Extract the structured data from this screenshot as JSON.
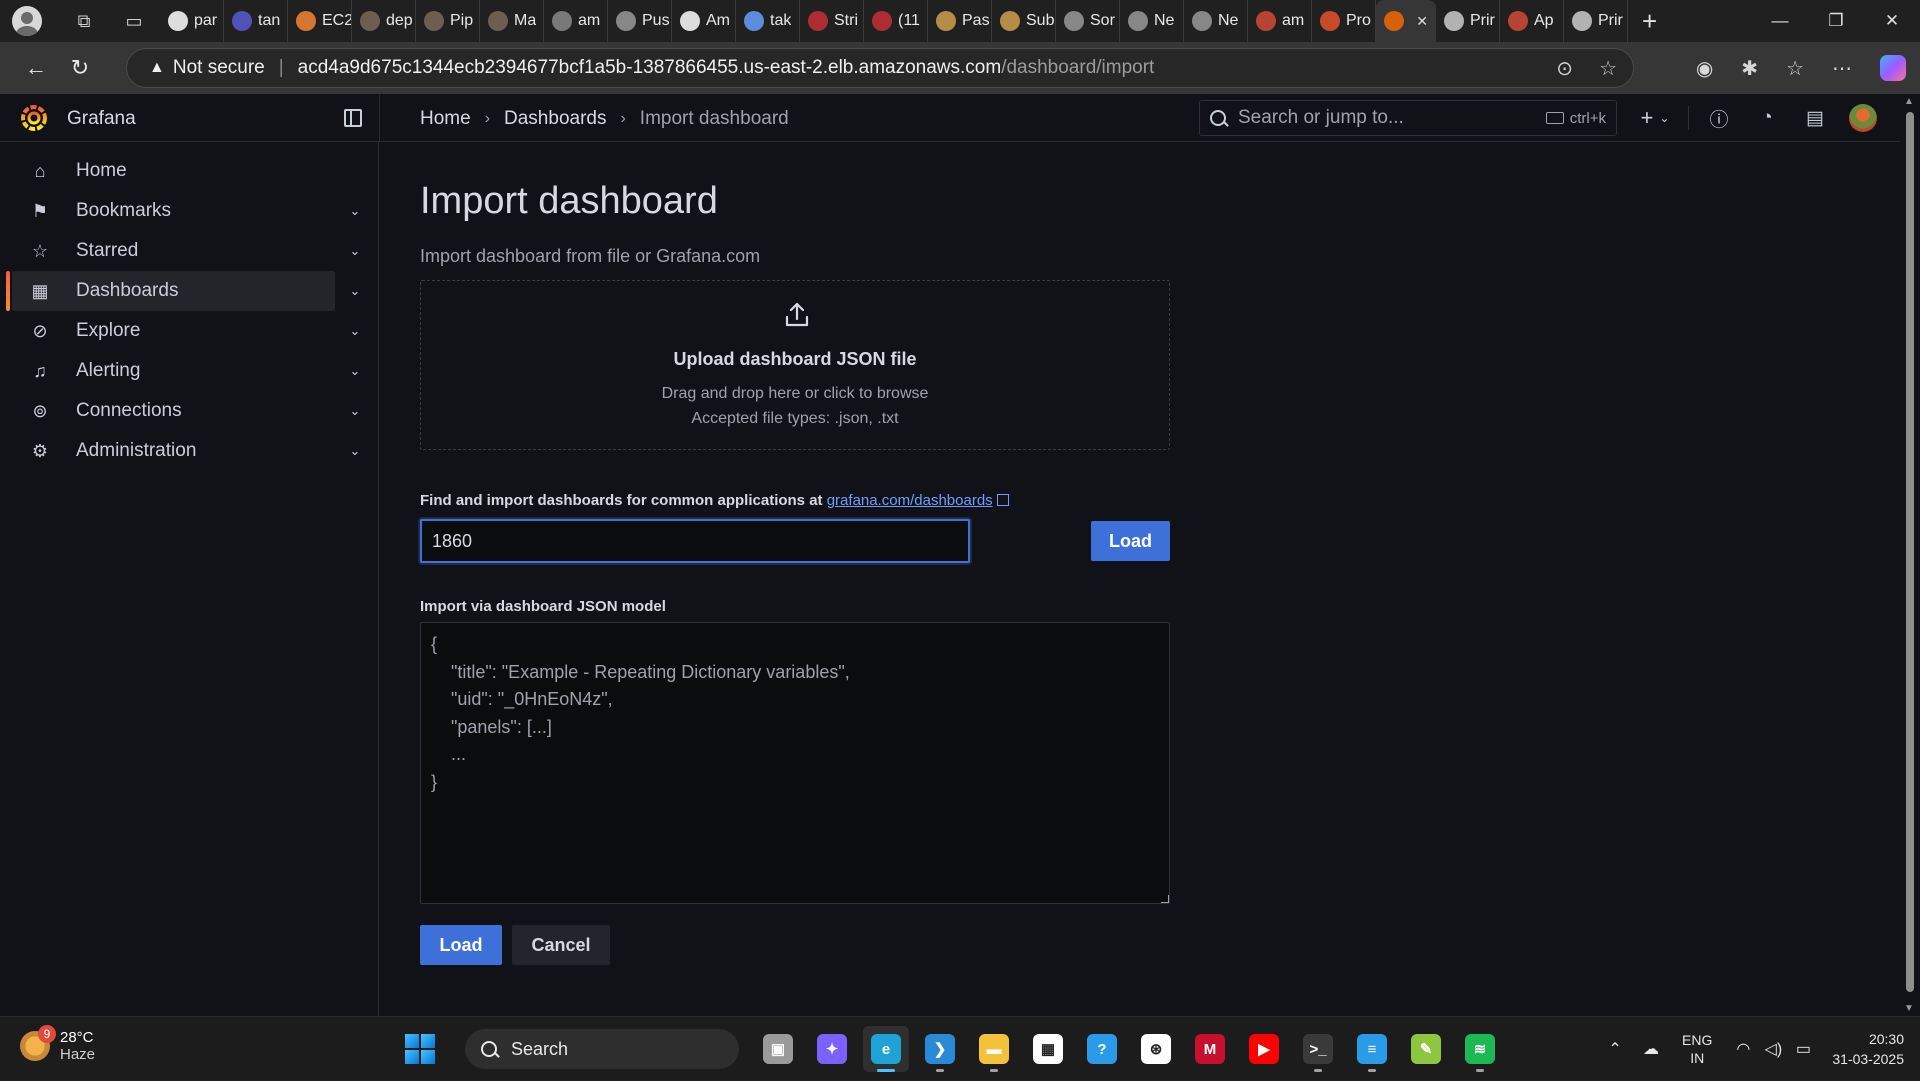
{
  "browser": {
    "tabs": [
      {
        "title": "par",
        "icon": "github-icon",
        "color": "#ffffff"
      },
      {
        "title": "tan",
        "icon": "extension-icon",
        "color": "#5b5bd6"
      },
      {
        "title": "EC2",
        "icon": "aws-ec2-icon",
        "color": "#f58536"
      },
      {
        "title": "dep",
        "icon": "user-avatar-icon",
        "color": "#7a6a5a"
      },
      {
        "title": "Pip",
        "icon": "user-avatar-icon",
        "color": "#7a6a5a"
      },
      {
        "title": "Ma",
        "icon": "user-avatar-icon",
        "color": "#7a6a5a"
      },
      {
        "title": "am",
        "icon": "feather-icon",
        "color": "#8a8a8a"
      },
      {
        "title": "Pus",
        "icon": "openai-icon",
        "color": "#9a9a9a"
      },
      {
        "title": "Am",
        "icon": "github-icon",
        "color": "#ffffff"
      },
      {
        "title": "tak",
        "icon": "search-icon",
        "color": "#6aa0ff"
      },
      {
        "title": "Stri",
        "icon": "flipkart-icon",
        "color": "#c8303a"
      },
      {
        "title": "(11",
        "icon": "youtube-icon",
        "color": "#c8303a"
      },
      {
        "title": "Pas",
        "icon": "dev-icon",
        "color": "#d0a050"
      },
      {
        "title": "Sub",
        "icon": "dev-icon",
        "color": "#d0a050"
      },
      {
        "title": "Sor",
        "icon": "openai-icon",
        "color": "#9a9a9a"
      },
      {
        "title": "Ne",
        "icon": "page-icon",
        "color": "#9a9a9a"
      },
      {
        "title": "Ne",
        "icon": "page-icon",
        "color": "#9a9a9a"
      },
      {
        "title": "am",
        "icon": "prometheus-icon",
        "color": "#d24a3a"
      },
      {
        "title": "Pro",
        "icon": "prometheus-icon",
        "color": "#e6522c"
      }
    ],
    "active_tab": {
      "icon": "grafana-icon",
      "color": "#f46800"
    },
    "tabs_after": [
      {
        "title": "Prir",
        "icon": "globe-icon",
        "color": "#cccccc"
      },
      {
        "title": "Ap",
        "icon": "prometheus-icon",
        "color": "#d24a3a"
      },
      {
        "title": "Prir",
        "icon": "globe-icon",
        "color": "#cccccc"
      }
    ],
    "security_label": "Not secure",
    "url_host": "acd4a9d675c1344ecb2394677bcf1a5b-1387866455.us-east-2.elb.amazonaws.com",
    "url_path": "/dashboard/import"
  },
  "grafana": {
    "brand": "Grafana",
    "breadcrumb": {
      "home": "Home",
      "dashboards": "Dashboards",
      "current": "Import dashboard"
    },
    "search": {
      "placeholder": "Search or jump to...",
      "shortcut": "ctrl+k"
    },
    "sidebar": {
      "items": [
        {
          "label": "Home",
          "icon": "home-icon"
        },
        {
          "label": "Bookmarks",
          "icon": "bookmark-icon"
        },
        {
          "label": "Starred",
          "icon": "star-icon"
        },
        {
          "label": "Dashboards",
          "icon": "apps-icon"
        },
        {
          "label": "Explore",
          "icon": "compass-icon"
        },
        {
          "label": "Alerting",
          "icon": "bell-icon"
        },
        {
          "label": "Connections",
          "icon": "connections-icon"
        },
        {
          "label": "Administration",
          "icon": "cog-icon"
        }
      ]
    },
    "page": {
      "title": "Import dashboard",
      "subtitle": "Import dashboard from file or Grafana.com",
      "upload": {
        "title": "Upload dashboard JSON file",
        "hint": "Drag and drop here or click to browse",
        "types": "Accepted file types: .json, .txt"
      },
      "find_label": "Find and import dashboards for common applications at",
      "find_link": "grafana.com/dashboards",
      "id_value": "1860",
      "load_label": "Load",
      "json_label": "Import via dashboard JSON model",
      "json_placeholder": "{\n    \"title\": \"Example - Repeating Dictionary variables\",\n    \"uid\": \"_0HnEoN4z\",\n    \"panels\": [...]\n    ...\n}",
      "submit_label": "Load",
      "cancel_label": "Cancel"
    },
    "accent": "#3d71d9"
  },
  "taskbar": {
    "weather_badge": "9",
    "temperature": "28°C",
    "condition": "Haze",
    "search_label": "Search",
    "apps": [
      {
        "icon": "task-view-icon",
        "color": "#9a9a9a",
        "glyph": "▣"
      },
      {
        "icon": "copilot-icon",
        "color": "#7b61ff",
        "glyph": "✦"
      },
      {
        "icon": "edge-icon",
        "color": "#1fa3d6",
        "glyph": "e"
      },
      {
        "icon": "vscode-icon",
        "color": "#2b8ad8",
        "glyph": "❯"
      },
      {
        "icon": "file-explorer-icon",
        "color": "#f3c13a",
        "glyph": "▬"
      },
      {
        "icon": "microsoft-store-icon",
        "color": "#ffffff",
        "glyph": "▦"
      },
      {
        "icon": "help-icon",
        "color": "#2a9be8",
        "glyph": "?"
      },
      {
        "icon": "chatgpt-icon",
        "color": "#ffffff",
        "glyph": "⊛"
      },
      {
        "icon": "mcafee-icon",
        "color": "#c8102e",
        "glyph": "M"
      },
      {
        "icon": "youtube-icon",
        "color": "#ff0000",
        "glyph": "▶"
      },
      {
        "icon": "terminal-icon",
        "color": "#3a3a3a",
        "glyph": ">_"
      },
      {
        "icon": "notepad-icon",
        "color": "#2a9be8",
        "glyph": "≡"
      },
      {
        "icon": "notepad-plus-icon",
        "color": "#8ec63f",
        "glyph": "✎"
      },
      {
        "icon": "spotify-icon",
        "color": "#1db954",
        "glyph": "≋"
      }
    ],
    "language": "ENG",
    "region": "IN",
    "time": "20:30",
    "date": "31-03-2025"
  }
}
